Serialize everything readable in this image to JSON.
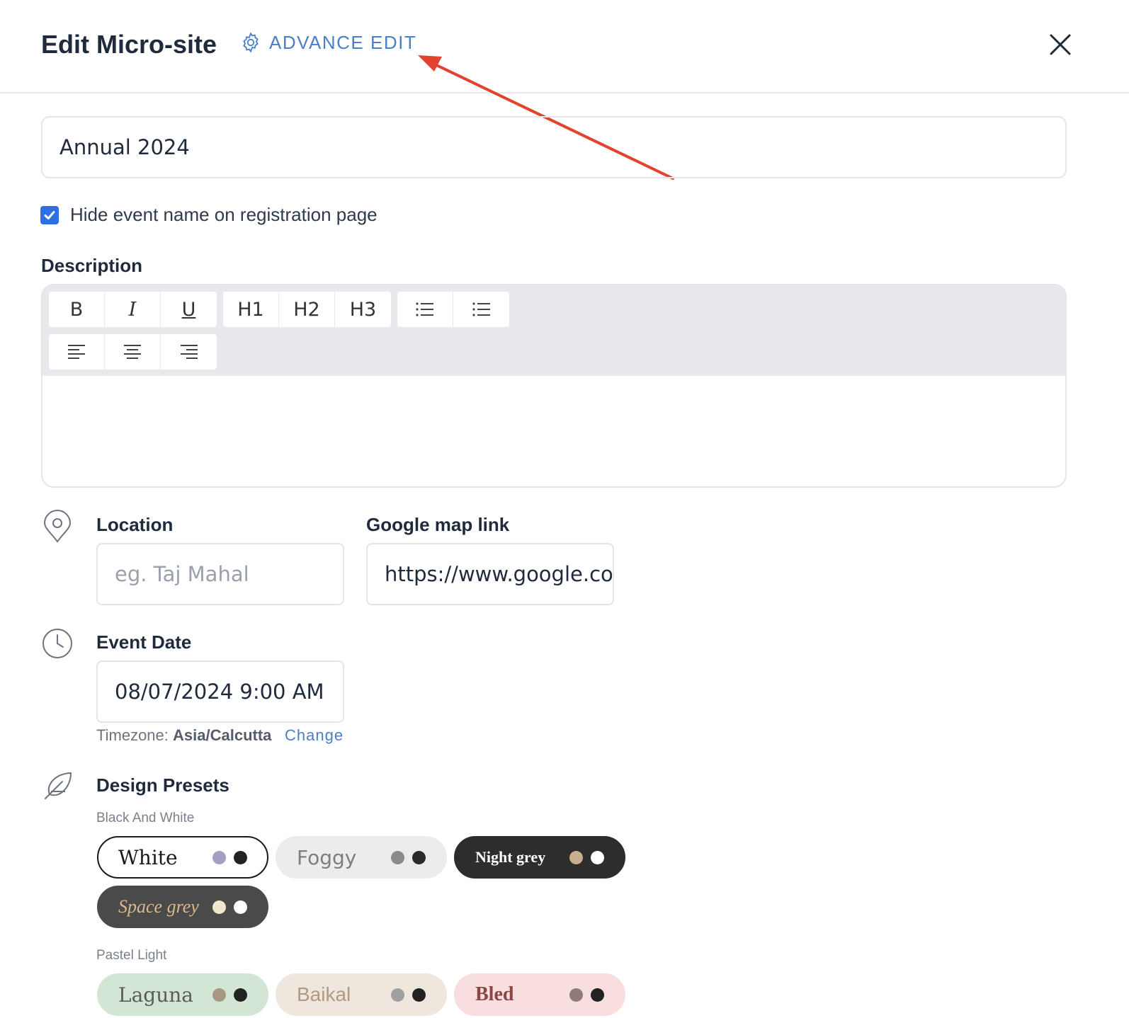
{
  "header": {
    "title": "Edit Micro-site",
    "advance_edit": "ADVANCE EDIT"
  },
  "event_name": {
    "value": "Annual 2024"
  },
  "hide_name": {
    "checked": true,
    "label": "Hide event name on registration page"
  },
  "description": {
    "label": "Description",
    "toolbar_row1": [
      [
        "B",
        "I",
        "U"
      ],
      [
        "H1",
        "H2",
        "H3"
      ],
      [
        "bullet-list",
        "numbered-list"
      ]
    ],
    "toolbar_row2": [
      "align-left",
      "align-center",
      "align-right"
    ]
  },
  "location": {
    "label": "Location",
    "placeholder": "eg. Taj Mahal",
    "map_label": "Google map link",
    "map_value": "https://www.google.co"
  },
  "event_date": {
    "label": "Event Date",
    "value": "08/07/2024 9:00 AM",
    "timezone_label": "Timezone:",
    "timezone_value": "Asia/Calcutta",
    "change": "Change"
  },
  "design_presets": {
    "label": "Design Presets",
    "groups": [
      {
        "name": "Black And White",
        "presets": [
          {
            "name": "White",
            "bg": "#ffffff",
            "fg": "#1a1a1a",
            "border": "#1a1a1a",
            "dots": [
              "#a4a0c4",
              "#222222"
            ]
          },
          {
            "name": "Foggy",
            "bg": "#ececed",
            "fg": "#7d7d82",
            "border": "#ececed",
            "dots": [
              "#8a8a8a",
              "#2a2a2a"
            ]
          },
          {
            "name": "Night grey",
            "bg": "#2d2d2d",
            "fg": "#ffffff",
            "border": "#2d2d2d",
            "dots": [
              "#c8ae90",
              "#ffffff"
            ]
          },
          {
            "name": "Space grey",
            "bg": "#4a4a4a",
            "fg": "#d9b98a",
            "border": "#4a4a4a",
            "dots": [
              "#f2e7cc",
              "#ffffff"
            ]
          }
        ]
      },
      {
        "name": "Pastel Light",
        "presets": [
          {
            "name": "Laguna",
            "bg": "#d3e6d6",
            "fg": "#5b5b5b",
            "border": "#d3e6d6",
            "dots": [
              "#a89780",
              "#222222"
            ]
          },
          {
            "name": "Baikal",
            "bg": "#efe7dd",
            "fg": "#b09a82",
            "border": "#efe7dd",
            "dots": [
              "#a0a0a0",
              "#222222"
            ]
          },
          {
            "name": "Bled",
            "bg": "#f8dede",
            "fg": "#8a4545",
            "border": "#f8dede",
            "dots": [
              "#8e7a7a",
              "#222222"
            ]
          }
        ]
      }
    ]
  },
  "colors": {
    "accent": "#4a80c9",
    "checkbox": "#2f6fe4",
    "annotation_arrow": "#e2432e"
  }
}
